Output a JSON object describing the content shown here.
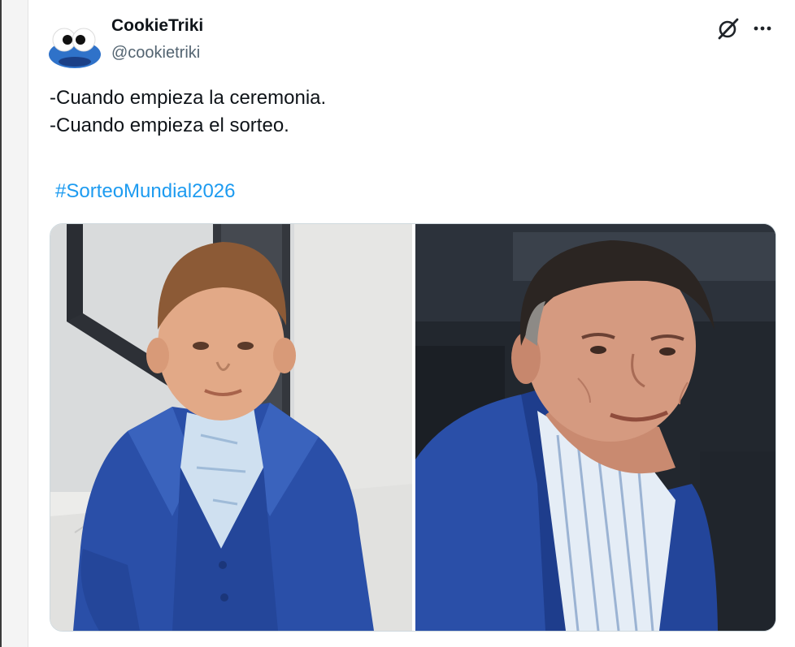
{
  "tweet": {
    "author": {
      "display_name": "CookieTriki",
      "handle": "@cookietriki"
    },
    "text_lines": [
      "-Cuando empieza la ceremonia.",
      "-Cuando empieza el sorteo."
    ],
    "hashtag": "#SorteoMundial2026",
    "header_icons": [
      "grok-icon",
      "more-options-icon"
    ],
    "media": {
      "count": 2,
      "items": [
        "photo-left",
        "photo-right"
      ]
    }
  },
  "colors": {
    "text_primary": "#0f1419",
    "text_secondary": "#536471",
    "link": "#1d9bf0",
    "suit_blue": "#2a4fa8"
  }
}
